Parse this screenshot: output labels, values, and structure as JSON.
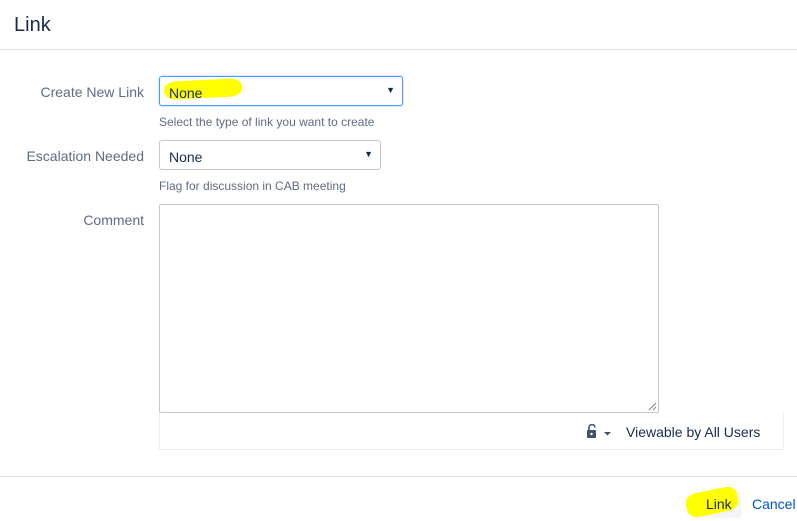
{
  "dialog": {
    "title": "Link"
  },
  "form": {
    "create_new_link": {
      "label": "Create New Link",
      "value": "None",
      "help": "Select the type of link you want to create"
    },
    "escalation_needed": {
      "label": "Escalation Needed",
      "value": "None",
      "help": "Flag for discussion in CAB meeting"
    },
    "comment": {
      "label": "Comment",
      "value": ""
    },
    "visibility": {
      "label": "Viewable by All Users",
      "icon": "unlock-icon"
    }
  },
  "footer": {
    "link_button": "Link",
    "cancel_link": "Cancel"
  },
  "colors": {
    "highlight": "#ffff00",
    "focus_border": "#4c9aff",
    "link_blue": "#0052cc"
  }
}
